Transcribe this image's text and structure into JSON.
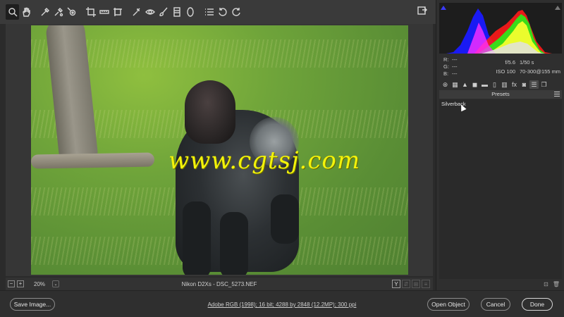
{
  "toolbar": {
    "tools": [
      {
        "name": "zoom-tool",
        "icon": "magnifier-icon"
      },
      {
        "name": "hand-tool",
        "icon": "hand-icon"
      },
      {
        "name": "white-balance-tool",
        "icon": "eyedropper-icon"
      },
      {
        "name": "color-sampler-tool",
        "icon": "color-sampler-icon"
      },
      {
        "name": "targeted-adjustment-tool",
        "icon": "target-adjust-icon"
      },
      {
        "name": "crop-tool",
        "icon": "crop-icon"
      },
      {
        "name": "straighten-tool",
        "icon": "straighten-icon"
      },
      {
        "name": "transform-tool",
        "icon": "transform-icon"
      },
      {
        "name": "spot-removal-tool",
        "icon": "spot-removal-icon"
      },
      {
        "name": "red-eye-tool",
        "icon": "red-eye-icon"
      },
      {
        "name": "adjustment-brush-tool",
        "icon": "brush-icon"
      },
      {
        "name": "graduated-filter-tool",
        "icon": "graduated-filter-icon"
      },
      {
        "name": "radial-filter-tool",
        "icon": "radial-filter-icon"
      },
      {
        "name": "preferences-tool",
        "icon": "list-icon"
      },
      {
        "name": "rotate-left-tool",
        "icon": "rotate-ccw-icon"
      },
      {
        "name": "rotate-right-tool",
        "icon": "rotate-cw-icon"
      }
    ]
  },
  "photo": {
    "watermark": "www.cgtsj.com"
  },
  "status": {
    "zoom_minus": "−",
    "zoom_plus": "+",
    "zoom_value": "20%",
    "zoom_caret": "⌄",
    "camera": "Nikon D2Xs",
    "separator": " - ",
    "filename": "DSC_5273.NEF",
    "view_y": "Y"
  },
  "readout": {
    "r_label": "R:",
    "r_value": "---",
    "g_label": "G:",
    "g_value": "---",
    "b_label": "B:",
    "b_value": "---",
    "aperture": "f/5.6",
    "shutter": "1/50 s",
    "iso": "ISO 100",
    "lens": "70-300@155 mm"
  },
  "presets": {
    "header": "Presets",
    "items": [
      "Silverback"
    ]
  },
  "bottom": {
    "save_label": "Save Image...",
    "workflow": "Adobe RGB (1998); 16 bit; 4288 by 2848 (12.2MP); 300 ppi",
    "open_label": "Open Object",
    "cancel_label": "Cancel",
    "done_label": "Done"
  },
  "colors": {
    "watermark": "#f3f30a",
    "panel_bg": "#2f2f2f",
    "toolbar_bg": "#3a3a3a"
  }
}
